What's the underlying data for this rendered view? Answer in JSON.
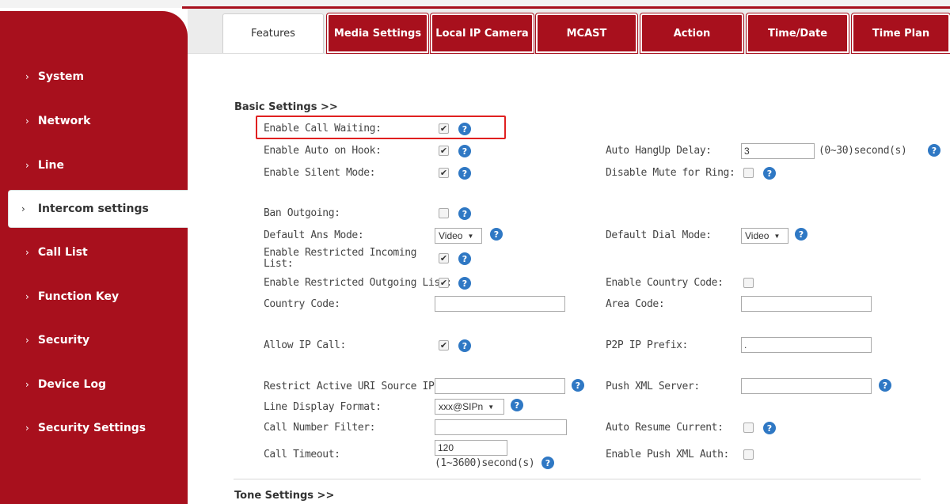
{
  "tabs": [
    {
      "label": "Features",
      "active": true
    },
    {
      "label": "Media Settings"
    },
    {
      "label": "Local IP Camera"
    },
    {
      "label": "MCAST"
    },
    {
      "label": "Action"
    },
    {
      "label": "Time/Date"
    },
    {
      "label": "Time Plan"
    }
  ],
  "sidebar": {
    "items": [
      {
        "label": "System"
      },
      {
        "label": "Network"
      },
      {
        "label": "Line"
      },
      {
        "label": "Intercom settings",
        "active": true
      },
      {
        "label": "Call List"
      },
      {
        "label": "Function Key"
      },
      {
        "label": "Security"
      },
      {
        "label": "Device Log"
      },
      {
        "label": "Security Settings"
      }
    ],
    "arrow": "›"
  },
  "sections": {
    "basic_title": "Basic Settings >>",
    "tone_title": "Tone Settings >>"
  },
  "help_glyph": "?",
  "check_glyph": "✔",
  "fields": {
    "call_waiting": {
      "label": "Enable Call Waiting:",
      "checked": true
    },
    "auto_on_hook": {
      "label": "Enable Auto on Hook:",
      "checked": true
    },
    "silent_mode": {
      "label": "Enable Silent Mode:",
      "checked": true
    },
    "auto_hangup_delay": {
      "label": "Auto HangUp Delay:",
      "value": "3",
      "unit": "(0~30)second(s)"
    },
    "disable_mute_ring": {
      "label": "Disable Mute for Ring:",
      "checked": false
    },
    "ban_outgoing": {
      "label": "Ban Outgoing:",
      "checked": false
    },
    "default_ans_mode": {
      "label": "Default Ans Mode:",
      "value": "Video"
    },
    "default_dial_mode": {
      "label": "Default Dial Mode:",
      "value": "Video"
    },
    "restricted_incoming": {
      "label_line1": "Enable Restricted Incoming",
      "label_line2": "List:",
      "checked": true
    },
    "restricted_outgoing": {
      "label": "Enable Restricted Outgoing List:",
      "checked": true
    },
    "country_code_enable": {
      "label": "Enable Country Code:",
      "checked": false
    },
    "country_code": {
      "label": "Country Code:",
      "value": ""
    },
    "area_code": {
      "label": "Area Code:",
      "value": ""
    },
    "allow_ip_call": {
      "label": "Allow IP Call:",
      "checked": true
    },
    "p2p_ip_prefix": {
      "label": "P2P IP Prefix:",
      "value": "."
    },
    "restrict_uri_ip": {
      "label": "Restrict Active URI Source IP:",
      "value": ""
    },
    "push_xml_server": {
      "label": "Push XML Server:",
      "value": ""
    },
    "line_display_format": {
      "label": "Line Display Format:",
      "value": "xxx@SIPn"
    },
    "call_number_filter": {
      "label": "Call Number Filter:",
      "value": ""
    },
    "auto_resume_current": {
      "label": "Auto Resume Current:",
      "checked": false
    },
    "call_timeout": {
      "label": "Call Timeout:",
      "value": "120",
      "unit": "(1~3600)second(s)"
    },
    "push_xml_auth": {
      "label": "Enable Push XML Auth:",
      "checked": false
    }
  },
  "colors": {
    "brand_red": "#a8101d",
    "help_blue": "#2f78c4",
    "highlight_red": "#e02020"
  }
}
